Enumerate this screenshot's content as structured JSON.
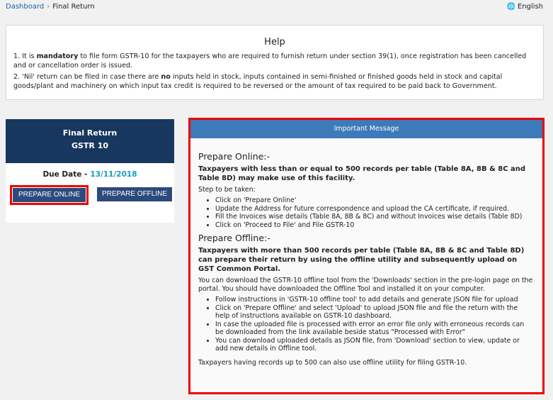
{
  "breadcrumb": {
    "home": "Dashboard",
    "current": "Final Return"
  },
  "language": "English",
  "help": {
    "title": "Help",
    "p1_prefix": "1. It is ",
    "p1_bold": "mandatory",
    "p1_suffix": " to file form GSTR-10 for the taxpayers who are required to furnish return under section 39(1), once registration has been cancelled and or cancellation order is issued.",
    "p2_prefix": "2. 'Nil' return can be filed in case there are ",
    "p2_bold": "no",
    "p2_suffix": " inputs held in stock, inputs contained in semi-finished or finished goods held in stock and capital goods/plant and machinery on which input tax credit is required to be reversed or the amount of tax required to be paid back to Government."
  },
  "return_box": {
    "title": "Final Return",
    "subtitle": "GSTR 10",
    "due_label": "Due Date -",
    "due_date": "13/11/2018",
    "online_label": "PREPARE ONLINE",
    "offline_label": "PREPARE OFFLINE"
  },
  "message": {
    "header": "Important Message",
    "online_title": "Prepare Online:-",
    "online_bold": "Taxpayers with less than or equal to 500 records per table (Table 8A, 8B & 8C and Table 8D) may make use of this facility.",
    "online_steps_label": "Step to be taken:",
    "online_steps": [
      "Click on 'Prepare Online'",
      "Update the Address for future correspondence and upload the CA certificate, if required.",
      "Fill the Invoices wise details (Table 8A, 8B & 8C) and without Invoices wise details (Table 8D)",
      "Click on 'Proceed to File' and File GSTR-10"
    ],
    "offline_title": "Prepare Offline:-",
    "offline_bold": "Taxpayers with more than 500 records per table (Table 8A, 8B & 8C and Table 8D) can prepare their return by using the offline utility and subsequently upload on GST Common Portal.",
    "offline_intro": "You can download the GSTR-10 offline tool from the 'Downloads' section in the pre-login page on the portal. You should have downloaded the Offline Tool and installed it on your computer.",
    "offline_steps": [
      "Follow instructions in 'GSTR-10 offline tool' to add details and generate JSON file for upload",
      "Click on 'Prepare Offline' and select 'Upload' to upload JSON file and file the return with the help of instructions available on GSTR-10 dashboard.",
      "In case the uploaded file is processed with error an error file only with erroneous records can be downloaded from the link available beside status \"Processed with Error\"",
      "You can download uploaded details as JSON file, from 'Download' section to view, update or add new details in Offline tool."
    ],
    "footer": "Taxpayers having records up to 500 can also use offline utility for filing GSTR-10."
  }
}
